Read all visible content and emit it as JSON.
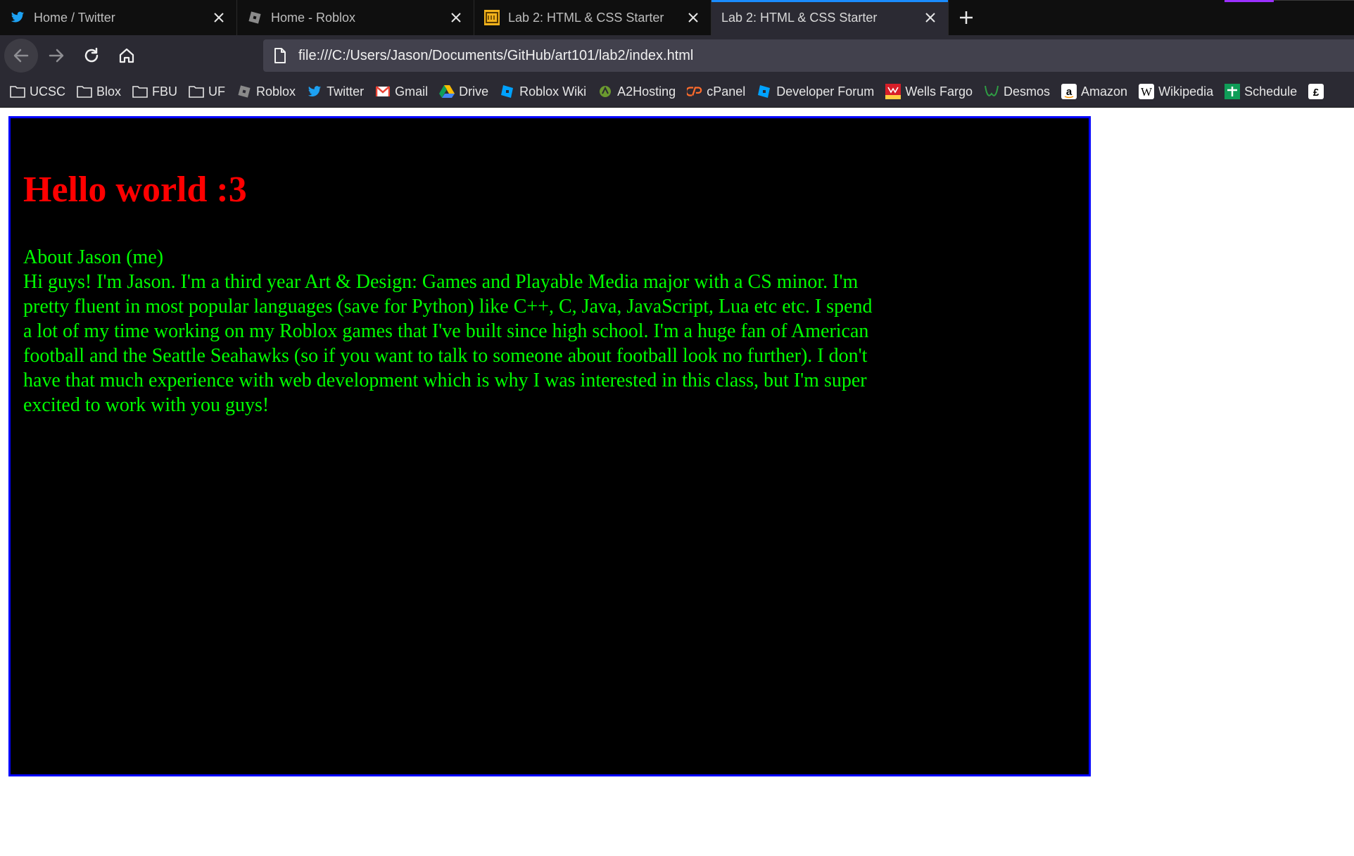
{
  "tabs": [
    {
      "title": "Home / Twitter",
      "icon": "twitter-icon",
      "active": false
    },
    {
      "title": "Home - Roblox",
      "icon": "roblox-icon",
      "active": false
    },
    {
      "title": "Lab 2: HTML & CSS Starter",
      "icon": "ucsc-icon",
      "active": false
    },
    {
      "title": "Lab 2: HTML & CSS Starter",
      "icon": "none",
      "active": true
    }
  ],
  "navbar": {
    "url": "file:///C:/Users/Jason/Documents/GitHub/art101/lab2/index.html"
  },
  "bookmarks": [
    {
      "label": "UCSC",
      "icon": "folder-icon"
    },
    {
      "label": "Blox",
      "icon": "folder-icon"
    },
    {
      "label": "FBU",
      "icon": "folder-icon"
    },
    {
      "label": "UF",
      "icon": "folder-icon"
    },
    {
      "label": "Roblox",
      "icon": "roblox-icon"
    },
    {
      "label": "Twitter",
      "icon": "twitter-icon"
    },
    {
      "label": "Gmail",
      "icon": "gmail-icon"
    },
    {
      "label": "Drive",
      "icon": "drive-icon"
    },
    {
      "label": "Roblox Wiki",
      "icon": "roblox-wiki-icon"
    },
    {
      "label": "A2Hosting",
      "icon": "a2hosting-icon"
    },
    {
      "label": "cPanel",
      "icon": "cpanel-icon"
    },
    {
      "label": "Developer Forum",
      "icon": "devforum-icon"
    },
    {
      "label": "Wells Fargo",
      "icon": "wells-fargo-icon"
    },
    {
      "label": "Desmos",
      "icon": "desmos-icon"
    },
    {
      "label": "Amazon",
      "icon": "amazon-icon"
    },
    {
      "label": "Wikipedia",
      "icon": "wikipedia-icon"
    },
    {
      "label": "Schedule",
      "icon": "schedule-icon"
    },
    {
      "label": "",
      "icon": "overflow-bookmark-icon"
    }
  ],
  "page": {
    "heading": "Hello world :3",
    "about_title": "About Jason (me)",
    "about_text": "Hi guys! I'm Jason. I'm a third year Art & Design: Games and Playable Media major with a CS minor. I'm pretty fluent in most popular languages (save for Python) like C++, C, Java, JavaScript, Lua etc etc. I spend a lot of my time working on my Roblox games that I've built since high school. I'm a huge fan of American football and the Seattle Seahawks (so if you want to talk to someone about football look no further). I don't have that much experience with web development which is why I was interested in this class, but I'm super excited to work with you guys!"
  },
  "colors": {
    "heading": "#ff0000",
    "body_text": "#00ff00",
    "content_bg": "#000000",
    "content_border": "#0000ff",
    "active_tab_indicator": "#1a8cff"
  }
}
